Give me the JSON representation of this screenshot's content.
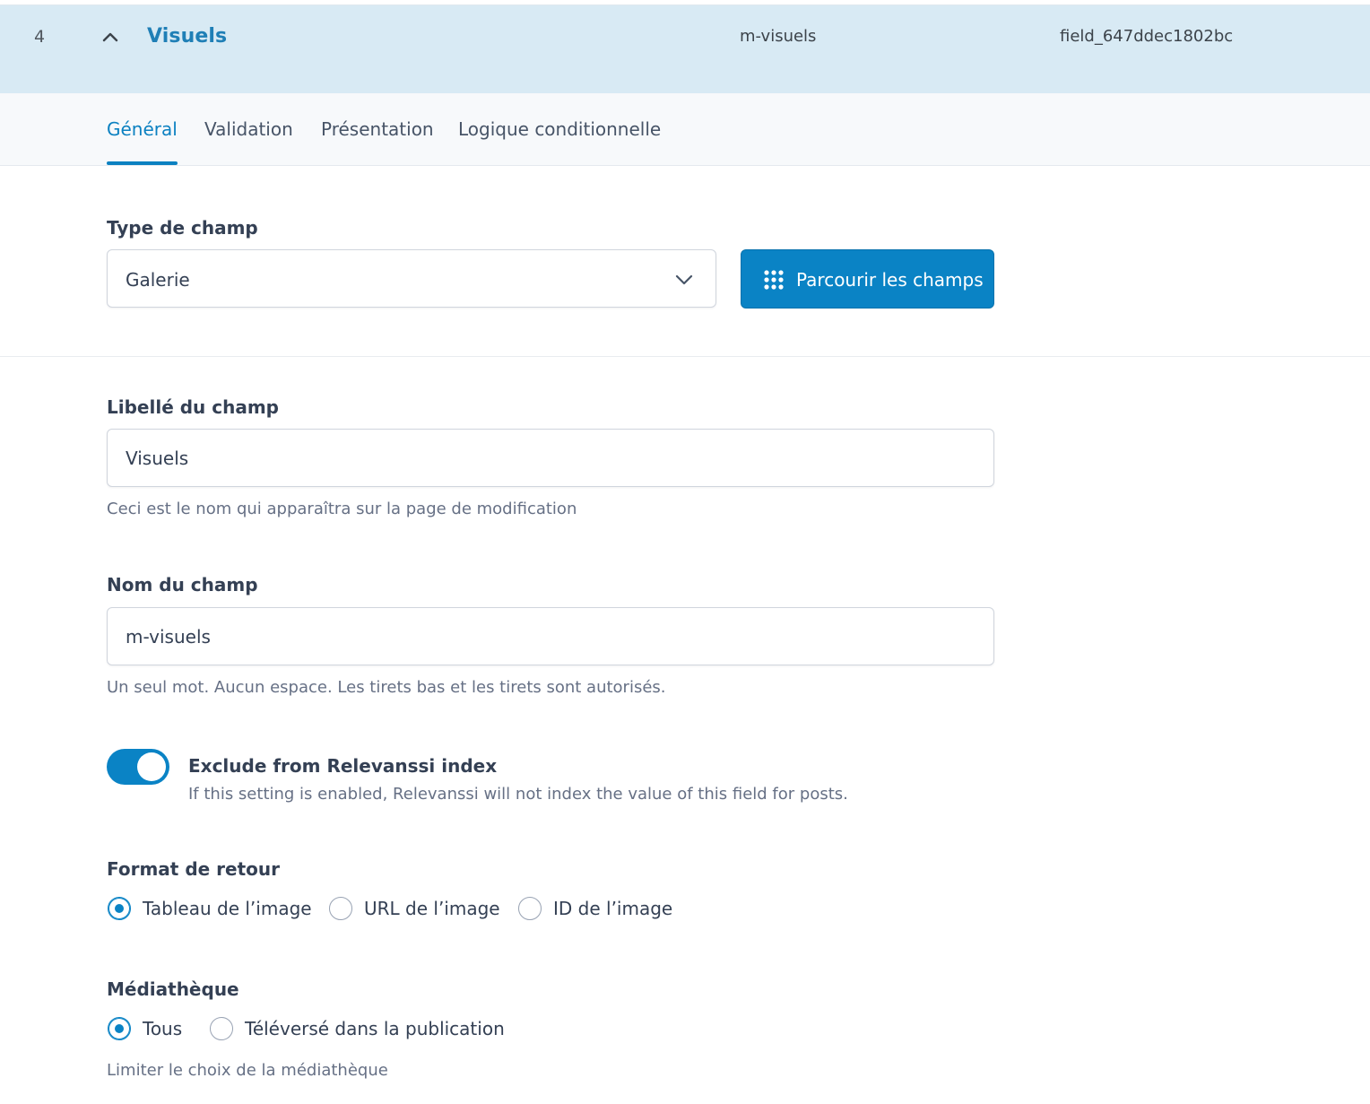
{
  "field_header": {
    "order": "4",
    "label": "Visuels",
    "name": "m-visuels",
    "key": "field_647ddec1802bc",
    "toggle_icon": "chevron-up-icon"
  },
  "tabs": [
    {
      "label": "Général",
      "active": true
    },
    {
      "label": "Validation",
      "active": false
    },
    {
      "label": "Présentation",
      "active": false
    },
    {
      "label": "Logique conditionnelle",
      "active": false
    }
  ],
  "field_type": {
    "label": "Type de champ",
    "value": "Galerie",
    "browse_button": "Parcourir les champs",
    "browse_icon": "grid-dots-icon"
  },
  "field_label": {
    "label": "Libellé du champ",
    "value": "Visuels",
    "help": "Ceci est le nom qui apparaîtra sur la page de modification"
  },
  "field_name": {
    "label": "Nom du champ",
    "value": "m-visuels",
    "help": "Un seul mot. Aucun espace. Les tirets bas et les tirets sont autorisés."
  },
  "relevanssi": {
    "enabled": true,
    "title": "Exclude from Relevanssi index",
    "help": "If this setting is enabled, Relevanssi will not index the value of this field for posts."
  },
  "return_format": {
    "label": "Format de retour",
    "options": [
      {
        "label": "Tableau de l’image",
        "checked": true
      },
      {
        "label": "URL de l’image",
        "checked": false
      },
      {
        "label": "ID de l’image",
        "checked": false
      }
    ]
  },
  "library": {
    "label": "Médiathèque",
    "options": [
      {
        "label": "Tous",
        "checked": true
      },
      {
        "label": "Téléversé dans la publication",
        "checked": false
      }
    ],
    "help": "Limiter le choix de la médiathèque"
  },
  "colors": {
    "accent": "#0a83c5",
    "header_bg": "#d8eaf4"
  }
}
